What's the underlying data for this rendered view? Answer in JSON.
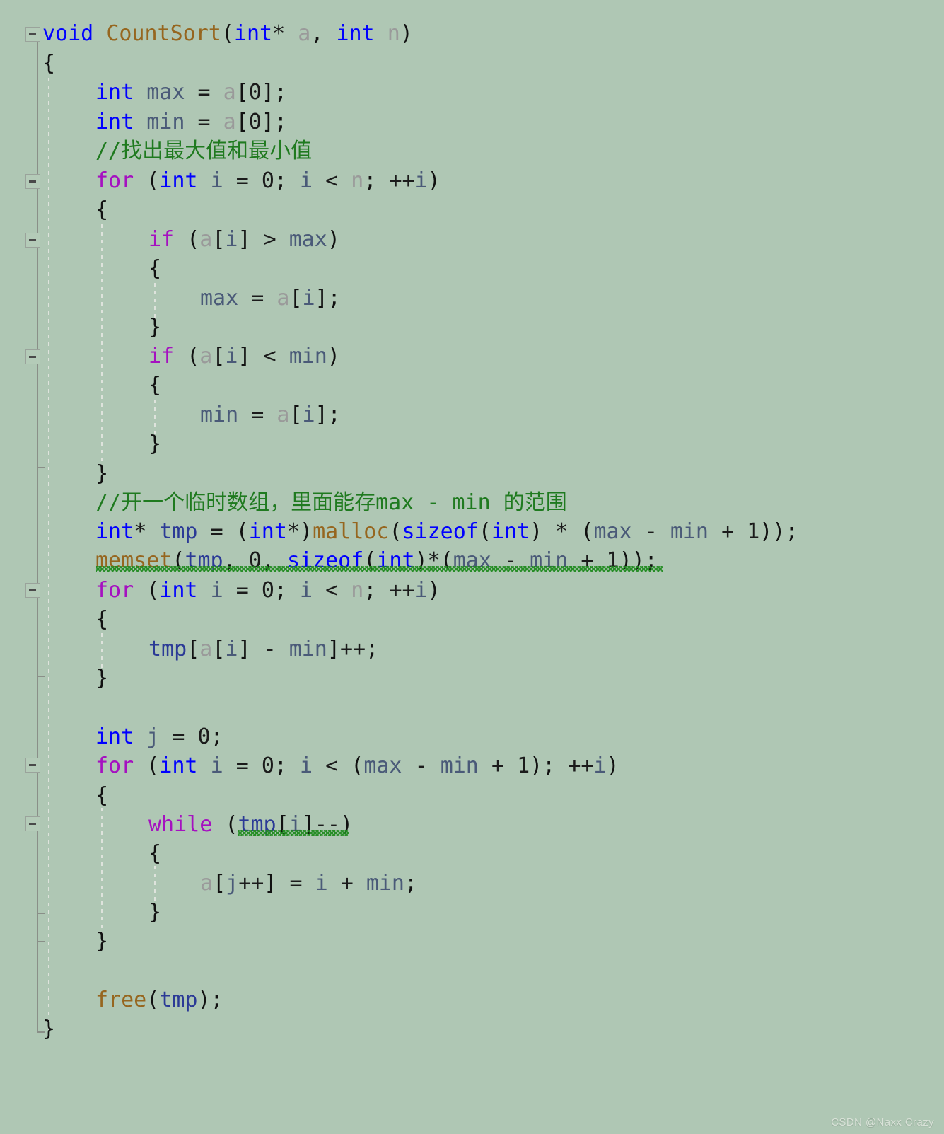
{
  "editor": {
    "background_color": "#afc7b4",
    "language": "C",
    "font_size_px": 30,
    "line_height_px": 41.6,
    "colors": {
      "keyword": "#0000ff",
      "control_keyword": "#a511c0",
      "function_name": "#96661f",
      "parameter": "#9a9a9a",
      "local_variable": "#4a5a78",
      "comment": "#1f7a1f",
      "punctuation": "#111111",
      "error_squiggle": "#1f8a1f",
      "fold_marker": "#8a8f88",
      "indent_guide": "#e6e8e3"
    }
  },
  "code": {
    "plain_text": "void CountSort(int* a, int n)\n{\n\tint max = a[0];\n\tint min = a[0];\n\t//找出最大值和最小值\n\tfor (int i = 0; i < n; ++i)\n\t{\n\t\tif (a[i] > max)\n\t\t{\n\t\t\tmax = a[i];\n\t\t}\n\t\tif (a[i] < min)\n\t\t{\n\t\t\tmin = a[i];\n\t\t}\n\t}\n\t//开一个临时数组，里面能存max - min 的范围\n\tint* tmp = (int*)malloc(sizeof(int) * (max - min + 1));\n\tmemset(tmp, 0, sizeof(int)*(max - min + 1));\n\tfor (int i = 0; i < n; ++i)\n\t{\n\t\ttmp[a[i] - min]++;\n\t}\n\n\tint j = 0;\n\tfor (int i = 0; i < (max - min + 1); ++i)\n\t{\n\t\twhile (tmp[i]--)\n\t\t{\n\t\t\ta[j++] = i + min;\n\t\t}\n\t}\n\n\tfree(tmp);\n}",
    "lines": [
      {
        "n": 1,
        "text": "void CountSort(int* a, int n)"
      },
      {
        "n": 2,
        "text": "{"
      },
      {
        "n": 3,
        "text": "    int max = a[0];"
      },
      {
        "n": 4,
        "text": "    int min = a[0];"
      },
      {
        "n": 5,
        "text": "    //找出最大值和最小值"
      },
      {
        "n": 6,
        "text": "    for (int i = 0; i < n; ++i)"
      },
      {
        "n": 7,
        "text": "    {"
      },
      {
        "n": 8,
        "text": "        if (a[i] > max)"
      },
      {
        "n": 9,
        "text": "        {"
      },
      {
        "n": 10,
        "text": "            max = a[i];"
      },
      {
        "n": 11,
        "text": "        }"
      },
      {
        "n": 12,
        "text": "        if (a[i] < min)"
      },
      {
        "n": 13,
        "text": "        {"
      },
      {
        "n": 14,
        "text": "            min = a[i];"
      },
      {
        "n": 15,
        "text": "        }"
      },
      {
        "n": 16,
        "text": "    }"
      },
      {
        "n": 17,
        "text": "    //开一个临时数组，里面能存max - min 的范围"
      },
      {
        "n": 18,
        "text": "    int* tmp = (int*)malloc(sizeof(int) * (max - min + 1));"
      },
      {
        "n": 19,
        "text": "    memset(tmp, 0, sizeof(int)*(max - min + 1));"
      },
      {
        "n": 20,
        "text": "    for (int i = 0; i < n; ++i)"
      },
      {
        "n": 21,
        "text": "    {"
      },
      {
        "n": 22,
        "text": "        tmp[a[i] - min]++;"
      },
      {
        "n": 23,
        "text": "    }"
      },
      {
        "n": 24,
        "text": ""
      },
      {
        "n": 25,
        "text": "    int j = 0;"
      },
      {
        "n": 26,
        "text": "    for (int i = 0; i < (max - min + 1); ++i)"
      },
      {
        "n": 27,
        "text": "    {"
      },
      {
        "n": 28,
        "text": "        while (tmp[i]--)"
      },
      {
        "n": 29,
        "text": "        {"
      },
      {
        "n": 30,
        "text": "            a[j++] = i + min;"
      },
      {
        "n": 31,
        "text": "        }"
      },
      {
        "n": 32,
        "text": "    }"
      },
      {
        "n": 33,
        "text": ""
      },
      {
        "n": 34,
        "text": "    free(tmp);"
      },
      {
        "n": 35,
        "text": "}"
      }
    ],
    "comments": [
      "//找出最大值和最小值",
      "//开一个临时数组，里面能存max - min 的范围"
    ],
    "error_underlines": [
      {
        "on_line": 19,
        "text": "memset(tmp, 0, sizeof(int)*(max - min + 1))"
      },
      {
        "on_line": 28,
        "text": "tmp[i]--"
      }
    ],
    "fold_markers": [
      {
        "on_line": 1,
        "state": "expanded",
        "glyph": "minus"
      },
      {
        "on_line": 6,
        "state": "expanded",
        "glyph": "minus"
      },
      {
        "on_line": 8,
        "state": "expanded",
        "glyph": "minus"
      },
      {
        "on_line": 12,
        "state": "expanded",
        "glyph": "minus"
      },
      {
        "on_line": 20,
        "state": "expanded",
        "glyph": "minus"
      },
      {
        "on_line": 26,
        "state": "expanded",
        "glyph": "minus"
      },
      {
        "on_line": 28,
        "state": "expanded",
        "glyph": "minus"
      }
    ]
  },
  "watermark": {
    "text": "CSDN @Naxx Crazy"
  }
}
